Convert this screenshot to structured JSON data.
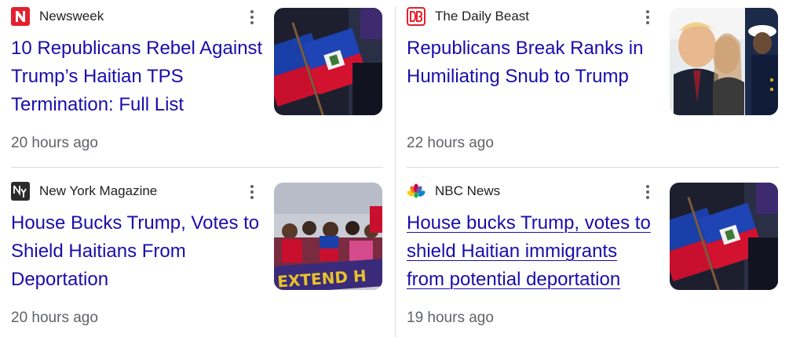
{
  "cards": [
    {
      "source": "Newsweek",
      "logo_icon": "newsweek-logo-icon",
      "headline": "10 Republicans Rebel Against Trump’s Haitian TPS Termination: Full List",
      "time": "20 hours ago",
      "image": "haitian-flags-image"
    },
    {
      "source": "The Daily Beast",
      "logo_icon": "daily-beast-logo-icon",
      "headline": "Republicans Break Ranks in Humiliating Snub to Trump",
      "time": "22 hours ago",
      "image": "trump-portrait-image"
    },
    {
      "source": "New York Magazine",
      "logo_icon": "new-york-magazine-logo-icon",
      "headline": "House Bucks Trump, Votes to Shield Haitians From Deportation",
      "time": "20 hours ago",
      "image": "protest-crowd-image",
      "image_text": "EXTEND H"
    },
    {
      "source": "NBC News",
      "logo_icon": "nbc-peacock-logo-icon",
      "headline": "House bucks Trump, votes to shield Haitian immigrants from potential deportation",
      "time": "19 hours ago",
      "image": "haitian-flags-image"
    }
  ],
  "colors": {
    "headline": "#1a0dab",
    "meta": "#5f6368",
    "source": "#202124",
    "divider": "#dadce0"
  }
}
